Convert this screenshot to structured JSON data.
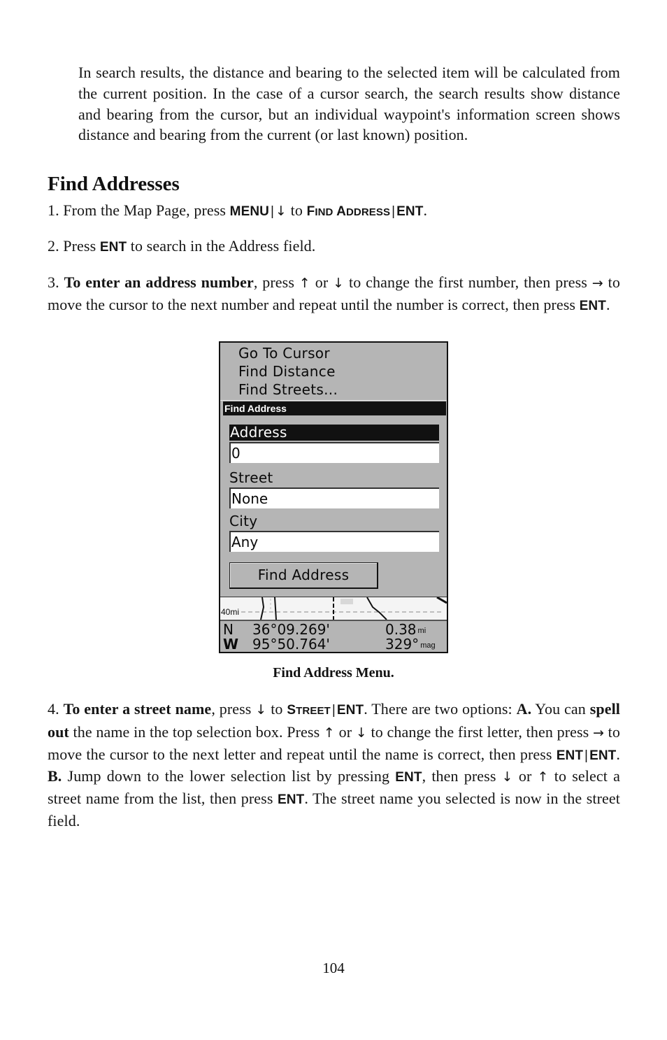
{
  "intro_paragraph": "In search results, the distance and bearing to the selected item will be calculated from the current position. In the case of a cursor search, the search results show distance and bearing from the cursor, but an individual waypoint's information screen shows distance and bearing from the current (or last known) position.",
  "section": {
    "title": "Find Addresses"
  },
  "steps": {
    "s1": {
      "prefix": "1. From the Map Page, press ",
      "key_menu": "MENU",
      "sep": "|",
      "arrow_down": "↓",
      "to": " to ",
      "key_find_F": "F",
      "key_find_ind": "IND",
      "key_find_A": " A",
      "key_find_ddress": "DDRESS",
      "key_ent": "ENT",
      "end": "."
    },
    "s2": {
      "prefix": "2. Press ",
      "key_ent": "ENT",
      "suffix": " to search in the Address field."
    },
    "s3": {
      "num": "3. ",
      "bold": "To enter an address number",
      "t1": ", press ",
      "up": "↑",
      "t2": " or ",
      "down": "↓",
      "t3": " to change the first number, then press ",
      "right": "→",
      "t4": " to move the cursor to the next number and repeat until the number is correct, then press ",
      "key_ent": "ENT",
      "end": "."
    },
    "s4": {
      "num": "4. ",
      "bold1": "To enter a street name",
      "t1": ", press ",
      "down": "↓",
      "t2": " to ",
      "key_street_S": "S",
      "key_street_rest": "TREET",
      "sep": "|",
      "key_ent": "ENT",
      "t3": ". There are two options: ",
      "boldA": "A.",
      "t4": " You can ",
      "bold2": "spell out",
      "t5": " the name in the top selection box. Press ",
      "up": "↑",
      "t6": " or ",
      "t7": " to change the first letter, then press ",
      "right": "→",
      "t8": " to move the cursor to the next letter and repeat until the name is correct, then press ",
      "t9": ". ",
      "boldB": "B.",
      "t10": " Jump down to the lower selection list by pressing ",
      "t11": ", then press ",
      "t12": " or ",
      "t13": " to select a street name from the list, then press ",
      "t14": ". The street name you selected is now in the street field."
    }
  },
  "device": {
    "menu_items": [
      "Go To Cursor",
      "Find Distance",
      "Find Streets..."
    ],
    "panel_title": "Find Address",
    "fields": {
      "address_label": "Address",
      "address_value": "0",
      "street_label": "Street",
      "street_value": "None",
      "city_label": "City",
      "city_value": "Any"
    },
    "find_button": "Find Address",
    "map_scale": "40mi",
    "status": {
      "n_label": "N",
      "w_label": "W",
      "latitude": "36°09.269'",
      "longitude": "95°50.764'",
      "distance": "0.38",
      "distance_unit": "mi",
      "bearing": "329°",
      "bearing_unit": "mag"
    }
  },
  "caption": "Find Address Menu.",
  "page_number": "104"
}
